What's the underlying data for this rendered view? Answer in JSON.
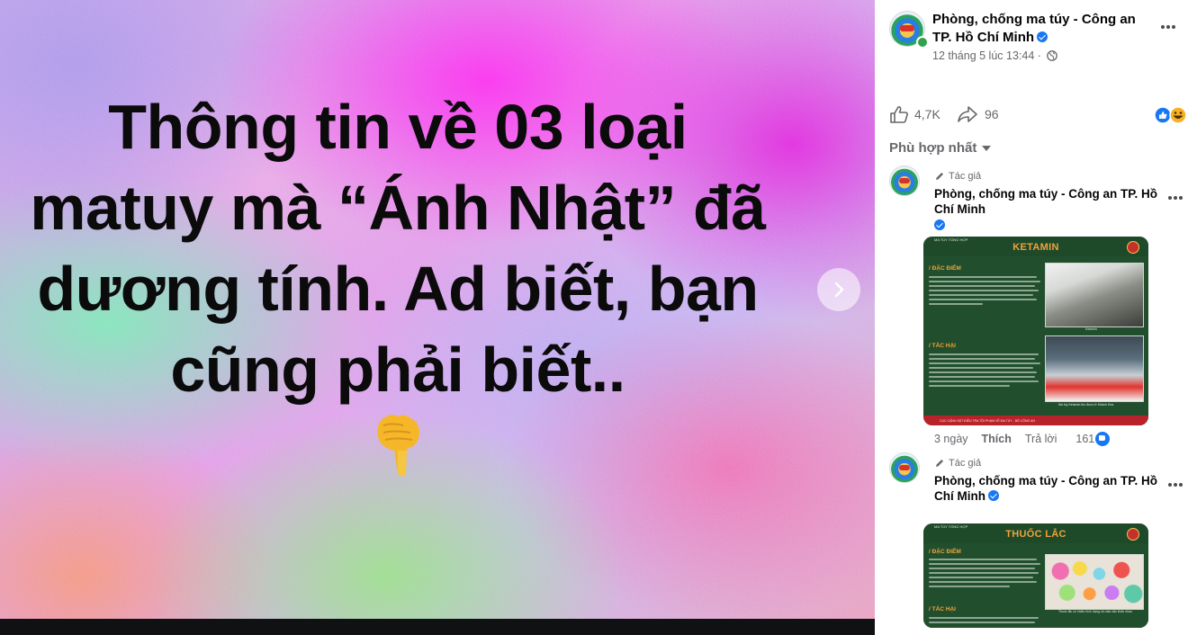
{
  "viewer": {
    "post_text_lines": [
      "Thông tin về 03 loại",
      "matuy mà “Ánh Nhật” đã",
      "dương tính. Ad biết, bạn",
      "cũng phải biết.."
    ]
  },
  "post": {
    "author": "Phòng, chống ma túy - Công an TP. Hồ Chí Minh",
    "date": "12 tháng 5 lúc 13:44",
    "date_separator": "·",
    "likes": "4,7K",
    "shares": "96"
  },
  "comments_header": {
    "sort_label": "Phù hợp nhất"
  },
  "comments": [
    {
      "badge": "Tác giả",
      "author": "Phòng, chống ma túy - Công an TP. Hồ Chí Minh",
      "time": "3 ngày",
      "like_label": "Thích",
      "reply_label": "Trả lời",
      "reaction_count": "161",
      "infographic": {
        "topline": "MA TÚY TỔNG HỢP",
        "title": "KETAMIN",
        "sections": [
          "/ ĐẶC ĐIỂM",
          "/ TÁC HẠI"
        ],
        "caption_1": "Ketamin",
        "caption_2": "Ma túy Ketamin thu được ở Khánh Hòa",
        "footer": "CỤC CẢNH SÁT ĐIỀU TRA TỘI PHẠM VỀ MA TÚY - BỘ CÔNG AN"
      }
    },
    {
      "badge": "Tác giả",
      "author": "Phòng, chống ma túy - Công an TP. Hồ Chí Minh",
      "infographic": {
        "topline": "MA TÚY TỔNG HỢP",
        "title": "THUỐC LẮC",
        "sections": [
          "/ ĐẶC ĐIỂM",
          "/ TÁC HẠI"
        ],
        "caption_1": "Thuốc lắc có nhiều hình dạng và màu sắc khác nhau"
      }
    }
  ],
  "colors": {
    "brand_blue": "#1877f2",
    "infographic_green": "#1f4a2a",
    "infographic_orange": "#f0a23b",
    "infographic_red": "#b8232b"
  }
}
